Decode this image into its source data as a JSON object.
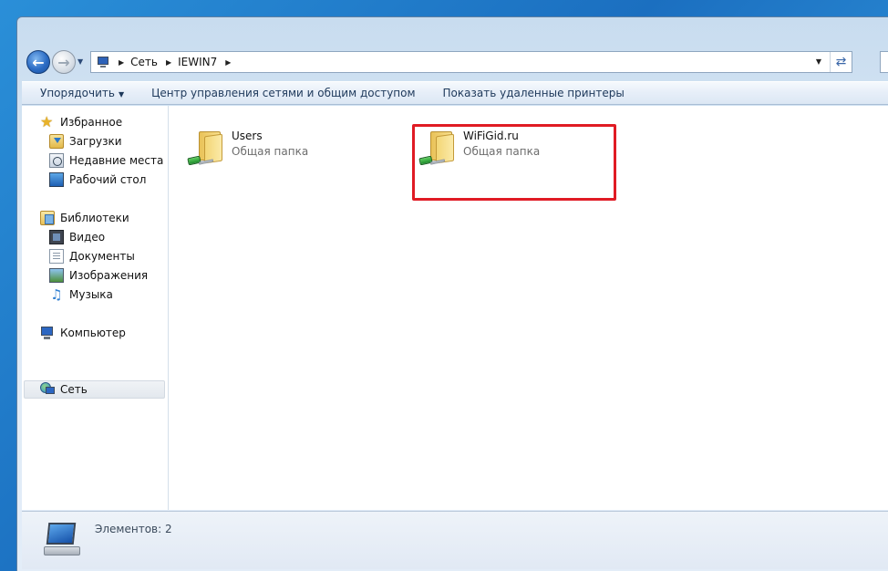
{
  "breadcrumb": {
    "items": [
      "Сеть",
      "IEWIN7"
    ]
  },
  "toolbar": {
    "organize": "Упорядочить",
    "network_center": "Центр управления сетями и общим доступом",
    "printers": "Показать удаленные принтеры"
  },
  "nav": {
    "favorites": "Избранное",
    "downloads": "Загрузки",
    "recent": "Недавние места",
    "desktop": "Рабочий стол",
    "libraries": "Библиотеки",
    "video": "Видео",
    "documents": "Документы",
    "images": "Изображения",
    "music": "Музыка",
    "computer": "Компьютер",
    "network": "Сеть"
  },
  "files": [
    {
      "name": "Users",
      "type": "Общая папка"
    },
    {
      "name": "WiFiGid.ru",
      "type": "Общая папка"
    }
  ],
  "details": {
    "count": "Элементов: 2"
  },
  "colors": {
    "highlight": "#e01b24",
    "accent": "#2c6cc4"
  },
  "icons": {
    "back": "back-arrow-icon",
    "forward": "forward-arrow-icon",
    "refresh": "refresh-icon",
    "shared_folder": "shared-folder-icon",
    "computer": "computer-icon",
    "network": "network-icon"
  }
}
